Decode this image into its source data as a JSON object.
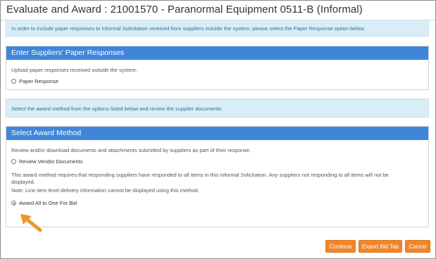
{
  "page": {
    "title": "Evaluate and Award : 21001570 - Paranormal Equipment 0511-B (Informal)"
  },
  "info_top": "In order to include paper responses to Informal Solicitation received from suppliers outside the system, please select the Paper Response option below.",
  "paper_panel": {
    "heading": "Enter Suppliers' Paper Responses",
    "description": "Upload paper responses received outside the system.",
    "radio_label": "Paper Response",
    "checked": false
  },
  "info_mid": "Select the award method from the options listed below and review the supplier documents.",
  "award_panel": {
    "heading": "Select Award Method",
    "description": "Review and/or download documents and attachments submitted by suppliers as part of their response.",
    "review_label": "Review Vendor Documents",
    "review_checked": false,
    "note_line1": "This award method requires that responding suppliers have responded to all items in this Informal Solicitation. Any suppliers not responding to all items will not be",
    "note_line2": "displayed.",
    "note_line3": "Note: Line item level delivery information cannot be displayed using this method.",
    "award_label": "Award All to One For Bid",
    "award_checked": true
  },
  "buttons": {
    "continue": "Continue",
    "export": "Export Bid Tab",
    "cancel": "Cancel"
  },
  "colors": {
    "panel_header": "#3f86d9",
    "info_bg": "#d9edf7",
    "button": "#f0852d",
    "arrow": "#f0962f"
  },
  "icons": {
    "callout": "arrow-pointer-icon"
  }
}
